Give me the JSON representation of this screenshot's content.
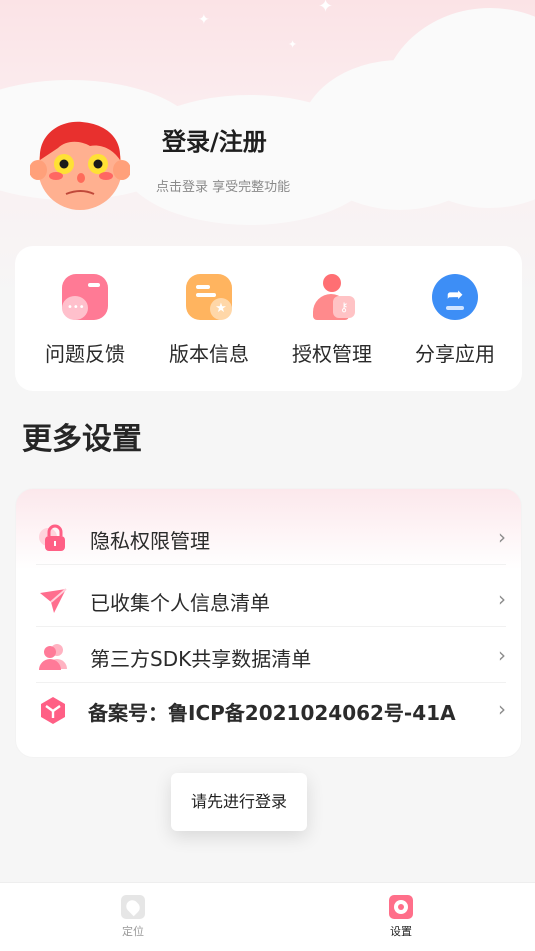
{
  "user": {
    "title": "登录/注册",
    "subtitle": "点击登录  享受完整功能"
  },
  "tools": [
    {
      "label": "问题反馈",
      "icon": "feedback-icon",
      "color": "#ff6f8a"
    },
    {
      "label": "版本信息",
      "icon": "version-info-icon",
      "color": "#ffb160"
    },
    {
      "label": "授权管理",
      "icon": "authorization-icon",
      "color": "#ff7a80"
    },
    {
      "label": "分享应用",
      "icon": "share-icon",
      "color": "#3c8cf5"
    }
  ],
  "more_settings": {
    "title": "更多设置",
    "items": [
      {
        "label": "隐私权限管理",
        "icon": "lock-icon"
      },
      {
        "label": "已收集个人信息清单",
        "icon": "paper-plane-icon"
      },
      {
        "label": "第三方SDK共享数据清单",
        "icon": "users-icon"
      },
      {
        "label": "备案号：鲁ICP备2021024062号-41A",
        "icon": "cube-icon"
      }
    ]
  },
  "toast": "请先进行登录",
  "tabbar": [
    {
      "label": "定位",
      "icon": "location-tab-icon",
      "active": false
    },
    {
      "label": "设置",
      "icon": "settings-tab-icon",
      "active": true
    }
  ],
  "colors": {
    "accent": "#ff6f8a",
    "tab_inactive": "#999999",
    "tab_active": "#222222"
  }
}
